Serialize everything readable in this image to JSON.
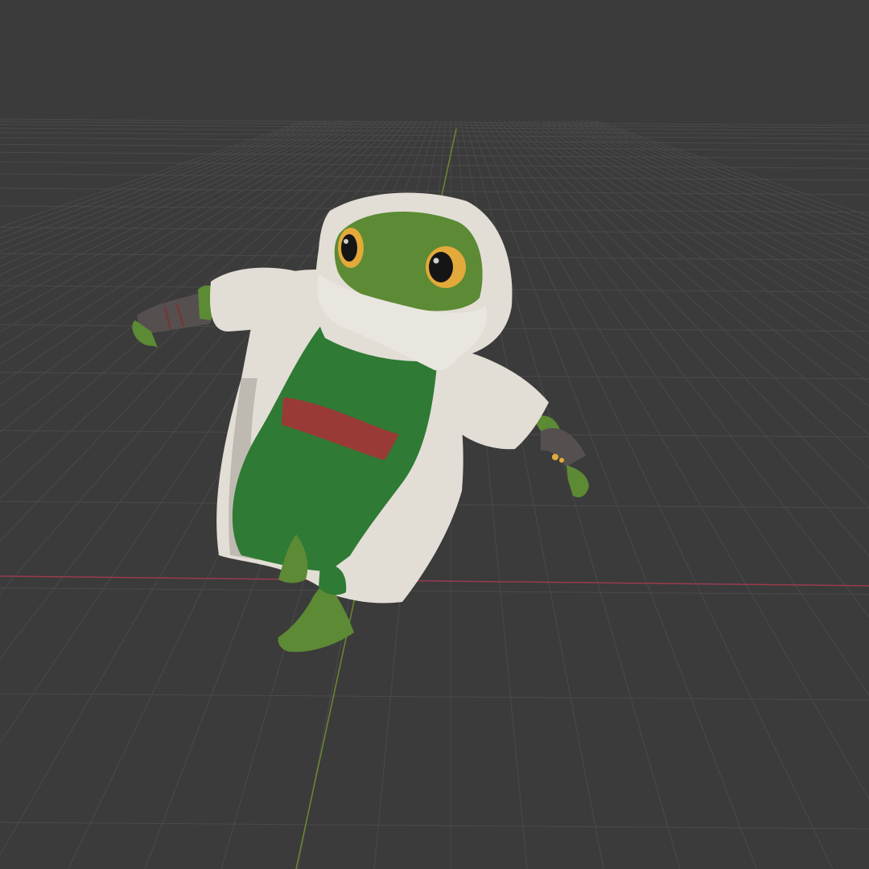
{
  "viewport": {
    "background_color": "#3b3b3b",
    "grid_color": "#4a4a4a",
    "x_axis_color": "#9a3b4f",
    "y_axis_color": "#6a8a2c"
  },
  "character": {
    "robe_color": "#e2ded6",
    "robe_shadow_color": "#bfbab1",
    "skin_color": "#5d8a34",
    "skin_dark_color": "#3f6a24",
    "tunic_color": "#2f7a34",
    "sash_color": "#9a3a36",
    "wrap_color": "#55504f",
    "eye_color": "#e3a93a"
  }
}
